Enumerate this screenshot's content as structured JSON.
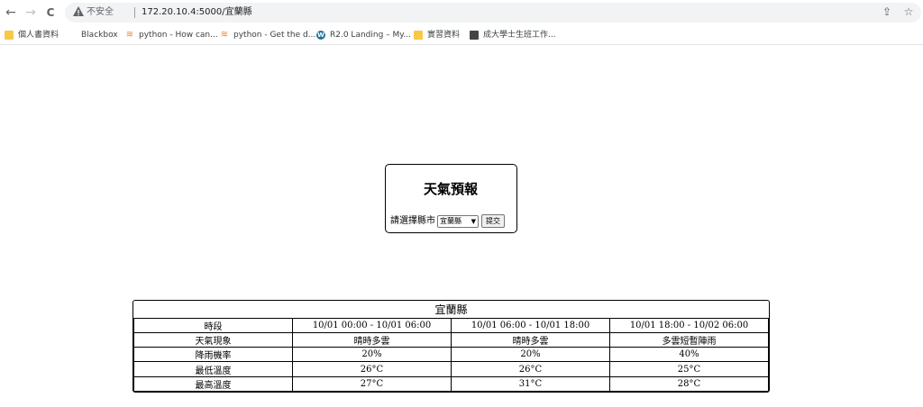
{
  "browser": {
    "not_secure_label": "不安全",
    "url": "172.20.10.4:5000/宜蘭縣",
    "back_glyph": "←",
    "forward_glyph": "→",
    "reload_glyph": "C",
    "share_glyph": "⇪",
    "star_glyph": "☆"
  },
  "bookmarks": [
    {
      "label": "個人書資料",
      "icon": "folder-icon"
    },
    {
      "label": "Blackbox",
      "icon": "blank-icon"
    },
    {
      "label": "python - How can...",
      "icon": "stackoverflow-icon"
    },
    {
      "label": "python - Get the d...",
      "icon": "stackoverflow-icon"
    },
    {
      "label": "R2.0 Landing – My...",
      "icon": "wordpress-icon"
    },
    {
      "label": "實習資料",
      "icon": "folder-icon"
    },
    {
      "label": "成大學士生班工作...",
      "icon": "document-icon"
    }
  ],
  "form": {
    "title": "天氣預報",
    "select_label": "請選擇縣市",
    "selected_county": "宜蘭縣",
    "submit_label": "提交"
  },
  "forecast": {
    "county": "宜蘭縣",
    "header_label": "時段",
    "periods": [
      "10/01 00:00 - 10/01 06:00",
      "10/01 06:00 - 10/01 18:00",
      "10/01 18:00 - 10/02 06:00"
    ],
    "rows": [
      {
        "label": "天氣現象",
        "values": [
          "晴時多雲",
          "晴時多雲",
          "多雲短暫陣雨"
        ]
      },
      {
        "label": "降雨機率",
        "values": [
          "20%",
          "20%",
          "40%"
        ]
      },
      {
        "label": "最低溫度",
        "values": [
          "26°C",
          "26°C",
          "25°C"
        ]
      },
      {
        "label": "最高溫度",
        "values": [
          "27°C",
          "31°C",
          "28°C"
        ]
      }
    ]
  },
  "colors": {
    "omnibox_bg": "#f1f3f4",
    "folder": "#f7c948",
    "border": "#000000"
  }
}
